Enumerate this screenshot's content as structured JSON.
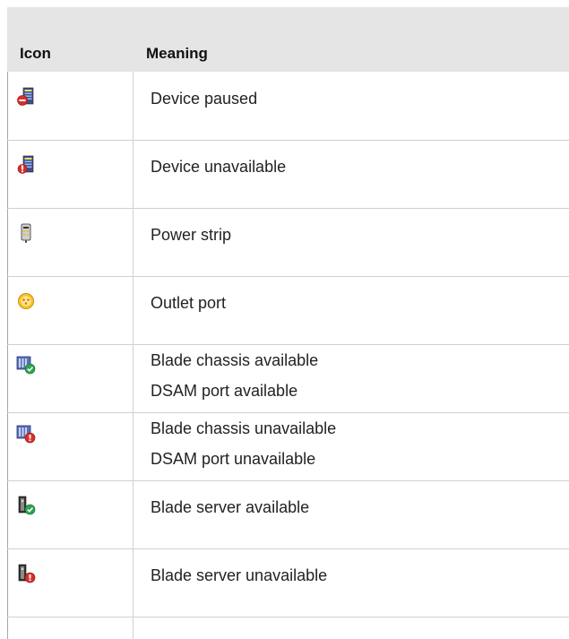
{
  "table": {
    "headers": {
      "icon": "Icon",
      "meaning": "Meaning"
    },
    "rows": [
      {
        "icon": "device-paused-icon",
        "meaning": [
          "Device paused"
        ]
      },
      {
        "icon": "device-unavailable-icon",
        "meaning": [
          "Device unavailable"
        ]
      },
      {
        "icon": "power-strip-icon",
        "meaning": [
          "Power strip"
        ]
      },
      {
        "icon": "outlet-port-icon",
        "meaning": [
          "Outlet port"
        ]
      },
      {
        "icon": "blade-chassis-available-icon",
        "meaning": [
          "Blade chassis available",
          "DSAM port available"
        ]
      },
      {
        "icon": "blade-chassis-unavailable-icon",
        "meaning": [
          "Blade chassis unavailable",
          "DSAM port unavailable"
        ]
      },
      {
        "icon": "blade-server-available-icon",
        "meaning": [
          "Blade server available"
        ]
      },
      {
        "icon": "blade-server-unavailable-icon",
        "meaning": [
          "Blade server unavailable"
        ]
      }
    ]
  }
}
